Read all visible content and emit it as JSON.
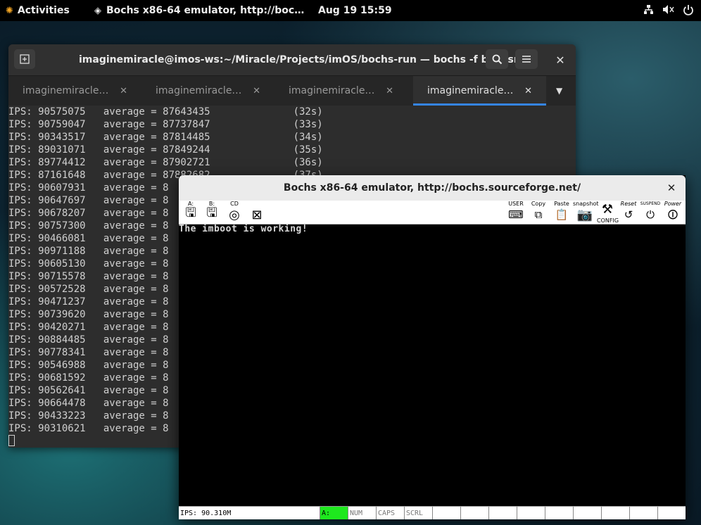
{
  "topbar": {
    "activities": "Activities",
    "app_title": "Bochs x86-64 emulator, http://boc…",
    "clock": "Aug 19  15:59",
    "icons": [
      "network-icon",
      "volume-icon",
      "power-icon"
    ]
  },
  "terminal": {
    "title": "imaginemiracle@imos-ws:~/Miracle/Projects/imOS/bochs-run — bochs -f bochsrc",
    "tabs": [
      {
        "label": "imaginemiracle…",
        "active": false
      },
      {
        "label": "imaginemiracle…",
        "active": false
      },
      {
        "label": "imaginemiracle…",
        "active": false
      },
      {
        "label": "imaginemiracle…",
        "active": true
      }
    ],
    "lines": [
      "IPS: 90575075   average = 87643435              (32s)",
      "IPS: 90759047   average = 87737847              (33s)",
      "IPS: 90343517   average = 87814485              (34s)",
      "IPS: 89031071   average = 87849244              (35s)",
      "IPS: 89774412   average = 87902721              (36s)",
      "IPS: 87161648   average = 87882682              (37s)",
      "IPS: 90607931   average = 8",
      "IPS: 90647697   average = 8",
      "IPS: 90678207   average = 8",
      "IPS: 90757300   average = 8",
      "IPS: 90466081   average = 8",
      "IPS: 90971188   average = 8",
      "IPS: 90605130   average = 8",
      "IPS: 90715578   average = 8",
      "IPS: 90572528   average = 8",
      "IPS: 90471237   average = 8",
      "IPS: 90739620   average = 8",
      "IPS: 90420271   average = 8",
      "IPS: 90884485   average = 8",
      "IPS: 90778341   average = 8",
      "IPS: 90546988   average = 8",
      "IPS: 90681592   average = 8",
      "IPS: 90562641   average = 8",
      "IPS: 90664478   average = 8",
      "IPS: 90433223   average = 8",
      "IPS: 90310621   average = 8"
    ]
  },
  "bochs": {
    "title": "Bochs x86-64 emulator, http://bochs.sourceforge.net/",
    "toolbar": {
      "floppy_a": "A:",
      "floppy_b": "B:",
      "cdrom": "CD",
      "user": "USER",
      "copy": "Copy",
      "paste": "Paste",
      "snapshot": "snapshot",
      "config": "CONFIG",
      "reset": "Reset",
      "suspend": "SUSPEND",
      "power": "Power"
    },
    "screen_text": "The imboot is working!",
    "status": {
      "ips": "IPS: 90.310M",
      "a": "A:",
      "num": "NUM",
      "caps": "CAPS",
      "scrl": "SCRL"
    }
  }
}
